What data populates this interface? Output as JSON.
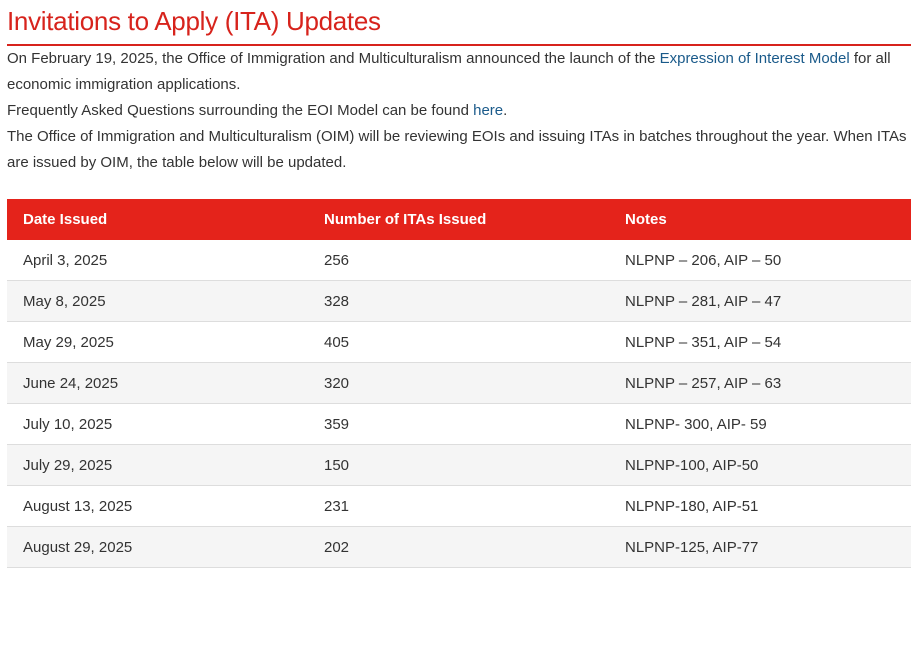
{
  "header": {
    "title": "Invitations to Apply (ITA) Updates"
  },
  "intro": {
    "p1_before": "On February 19, 2025, the Office of Immigration and Multiculturalism announced the launch of the ",
    "p1_link": "Expression of Interest Model",
    "p1_after": " for all economic immigration applications.",
    "p2_before": "Frequently Asked Questions surrounding the EOI Model can be found ",
    "p2_link": "here",
    "p2_after": ".",
    "p3": "The Office of Immigration and Multiculturalism (OIM) will be reviewing EOIs and issuing ITAs in batches throughout the year. When ITAs are issued by OIM, the table below will be updated."
  },
  "table": {
    "headers": [
      "Date Issued",
      "Number of ITAs Issued",
      "Notes"
    ],
    "rows": [
      {
        "date": "April 3, 2025",
        "count": "256",
        "notes": "NLPNP – 206,  AIP – 50"
      },
      {
        "date": "May 8, 2025",
        "count": "328",
        "notes": "NLPNP – 281,  AIP – 47"
      },
      {
        "date": "May 29, 2025",
        "count": "405",
        "notes": "NLPNP – 351,  AIP – 54"
      },
      {
        "date": "June 24, 2025",
        "count": "320",
        "notes": "NLPNP – 257,  AIP – 63"
      },
      {
        "date": "July 10, 2025",
        "count": "359",
        "notes": "NLPNP- 300,  AIP- 59"
      },
      {
        "date": "July 29, 2025",
        "count": "150",
        "notes": "NLPNP-100,  AIP-50"
      },
      {
        "date": "August 13, 2025",
        "count": "231",
        "notes": "NLPNP-180,  AIP-51"
      },
      {
        "date": "August 29, 2025",
        "count": "202",
        "notes": "NLPNP-125,  AIP-77"
      }
    ]
  },
  "colors": {
    "accent": "#e4231b",
    "title": "#d7231c",
    "link": "#1a5a8a"
  }
}
